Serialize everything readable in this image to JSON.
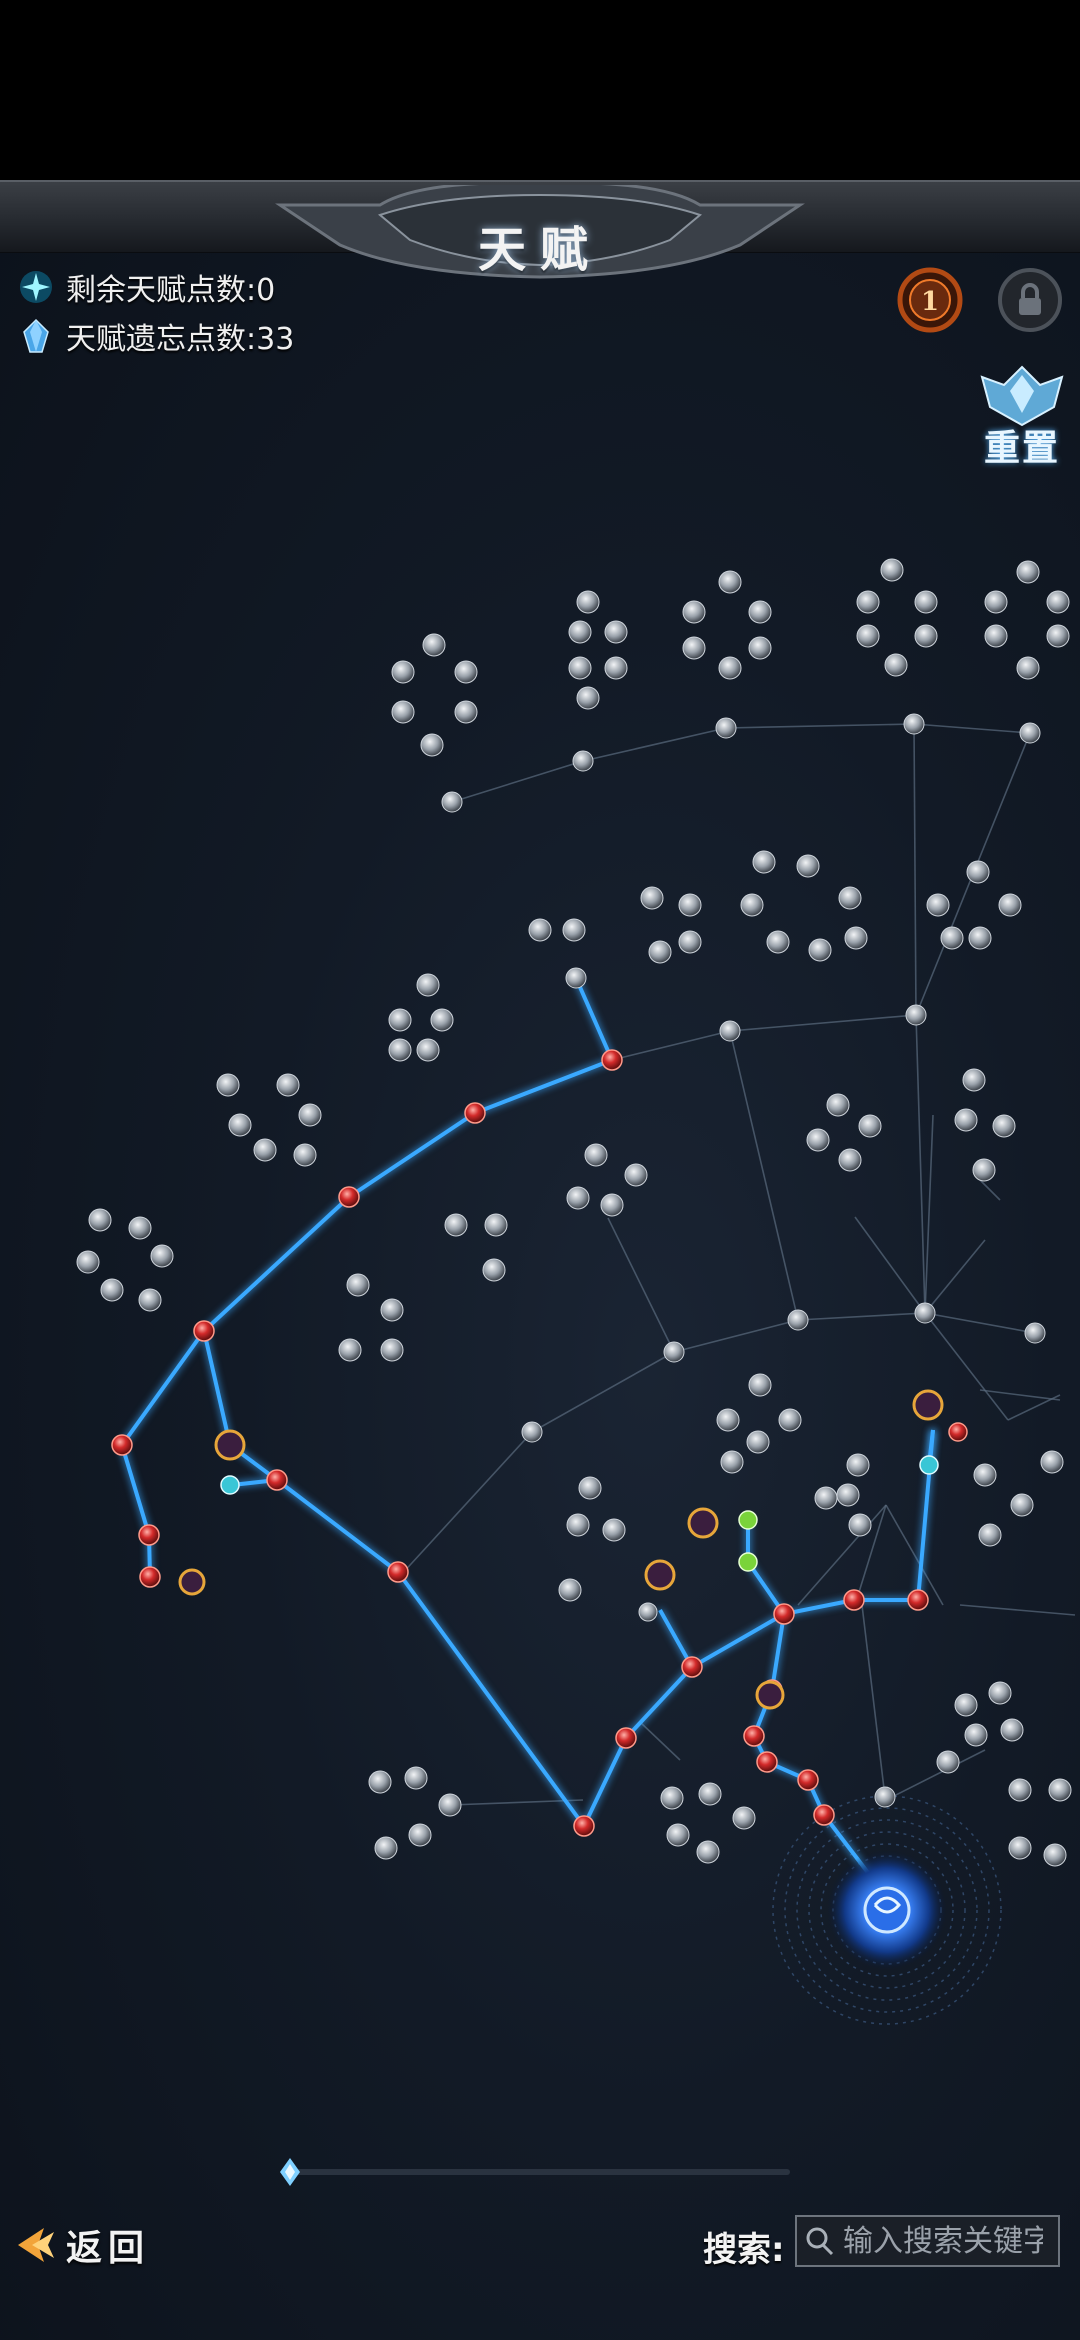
{
  "header": {
    "title": "天赋",
    "remaining_points_label": "剩余天赋点数:0",
    "forget_points_label": "天赋遗忘点数:33",
    "level_badge_icon": "level-medal-icon",
    "lock_icon": "lock-icon",
    "reset_label": "重置"
  },
  "talent_tree": {
    "center_node_icon": "origin-vortex-icon",
    "active_line_color": "#3aa9ff",
    "inactive_line_color": "#5a6b7e",
    "active_node_color": "#d23a3a"
  },
  "footer": {
    "back_label": "返回",
    "search_label": "搜索:",
    "search_placeholder": "输入搜索关键字"
  },
  "colors": {
    "background": "#121a26",
    "text": "#f0f0f0",
    "accent": "#4fb6ff"
  }
}
